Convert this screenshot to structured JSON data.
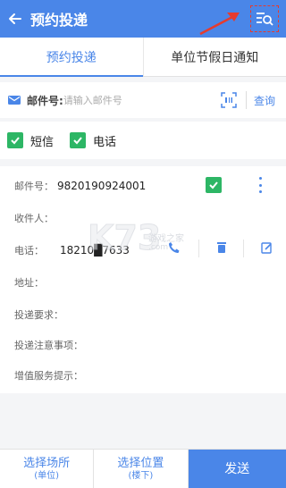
{
  "appbar": {
    "title": "预约投递"
  },
  "tabs": [
    {
      "label": "预约投递",
      "active": true
    },
    {
      "label": "单位节假日通知",
      "active": false
    }
  ],
  "search": {
    "label": "邮件号:",
    "placeholder": "请输入邮件号",
    "query_label": "查询"
  },
  "channels": [
    {
      "label": "短信",
      "checked": true
    },
    {
      "label": "电话",
      "checked": true
    }
  ],
  "record": {
    "mail_no_label": "邮件号：",
    "mail_no": "9820190924001",
    "recipient_label": "收件人：",
    "recipient": "",
    "phone_label": "电话：",
    "phone": "18210█7633",
    "address_label": "地址：",
    "requirement_label": "投递要求：",
    "notes_label": "投递注意事项：",
    "service_label": "增值服务提示：",
    "selected": true
  },
  "watermark": {
    "logo": "K73",
    "cn": "游戏之家",
    "url": ".com"
  },
  "bottom": {
    "place_label": "选择场所",
    "place_sub": "(单位)",
    "position_label": "选择位置",
    "position_sub": "(楼下)",
    "send_label": "发送"
  },
  "colors": {
    "primary": "#4a86e8",
    "check": "#2db665",
    "annotation": "#e63b2e"
  },
  "icons": [
    "back-arrow-icon",
    "list-search-icon",
    "mail-icon",
    "scan-icon",
    "checkmark-icon",
    "more-vertical-icon",
    "call-icon",
    "delete-icon",
    "edit-icon"
  ]
}
